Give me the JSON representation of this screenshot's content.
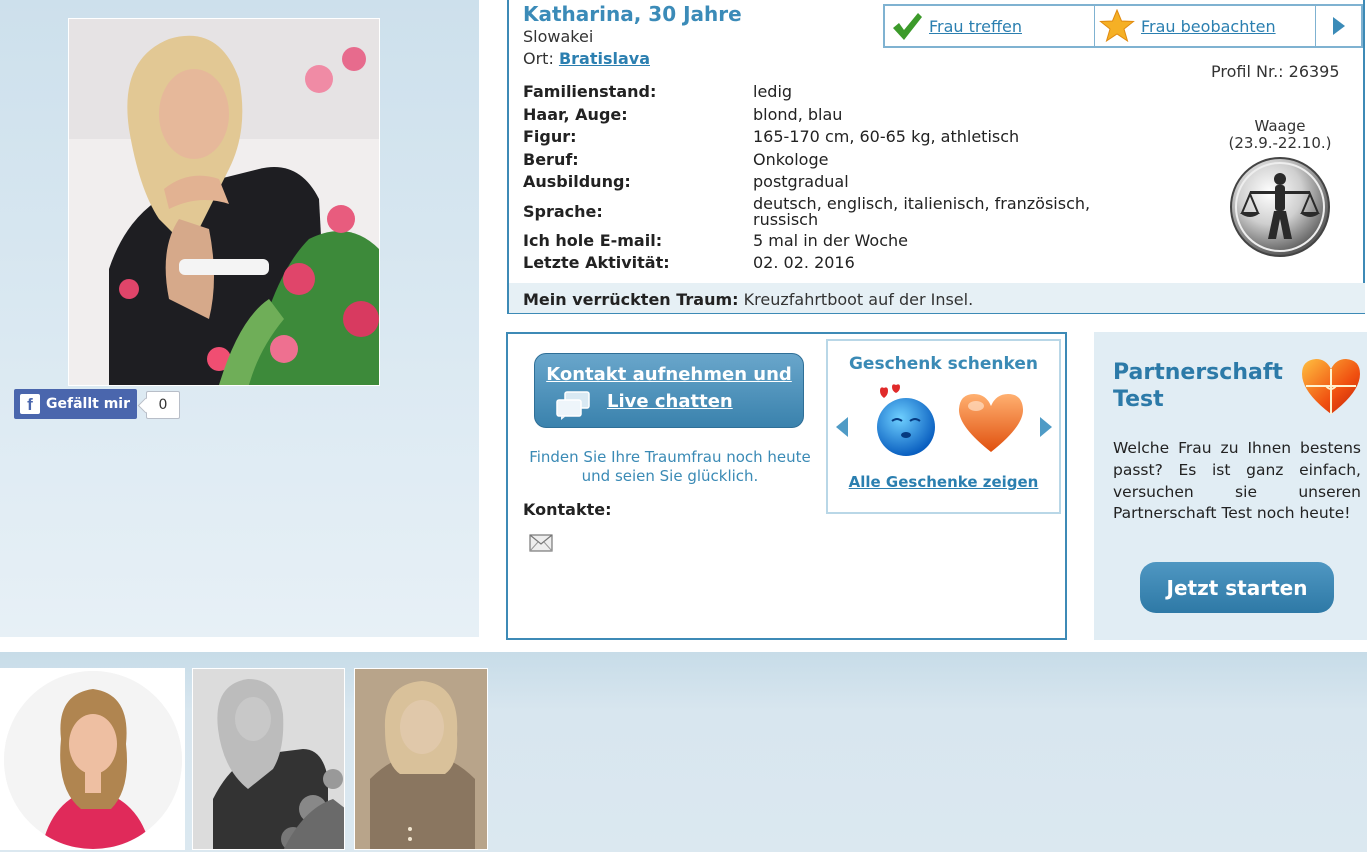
{
  "profile": {
    "name_age": "Katharina, 30 Jahre",
    "country": "Slowakei",
    "city_label": "Ort:",
    "city": "Bratislava",
    "profil_nr": "Profil Nr.: 26395"
  },
  "actions": {
    "meet": "Frau treffen",
    "watch": "Frau beobachten"
  },
  "details": [
    {
      "key": "Familienstand:",
      "value": "ledig"
    },
    {
      "key": "Haar, Auge:",
      "value": "blond, blau"
    },
    {
      "key": "Figur:",
      "value": "165-170 cm, 60-65 kg, athletisch"
    },
    {
      "key": "Beruf:",
      "value": "Onkologe"
    },
    {
      "key": "Ausbildung:",
      "value": "postgradual"
    },
    {
      "key": "Sprache:",
      "value": "deutsch, englisch, italienisch, französisch, russisch"
    },
    {
      "key": "Ich hole E-mail:",
      "value": "5 mal in der Woche"
    },
    {
      "key": "Letzte Aktivität:",
      "value": "02. 02. 2016"
    }
  ],
  "zodiac": {
    "name": "Waage",
    "range": "(23.9.-22.10.)",
    "icon": "libra-icon"
  },
  "dream": {
    "label": "Mein verrückten Traum:",
    "value": "Kreuzfahrtboot auf der Insel."
  },
  "facebook": {
    "like_label": "Gefällt mir",
    "count": "0"
  },
  "contact": {
    "button_line1": "Kontakt aufnehmen und",
    "button_line2": "Live chatten",
    "text": "Finden Sie Ihre Traumfrau noch heute und seien Sie glücklich.",
    "contacts_label": "Kontakte:"
  },
  "gift": {
    "title": "Geschenk schenken",
    "all_link": "Alle Geschenke zeigen"
  },
  "partner": {
    "title_line1": "Partnerschaft",
    "title_line2": "Test",
    "text": "Welche Frau zu Ihnen bestens passt? Es ist ganz einfach, versuchen sie unseren Partnerschaft Test noch heute!",
    "button": "Jetzt starten"
  },
  "colors": {
    "accent": "#3b8bb8",
    "link": "#2b7fb0",
    "panel_bg": "#dbe9f2",
    "button": "#3a82ad"
  }
}
